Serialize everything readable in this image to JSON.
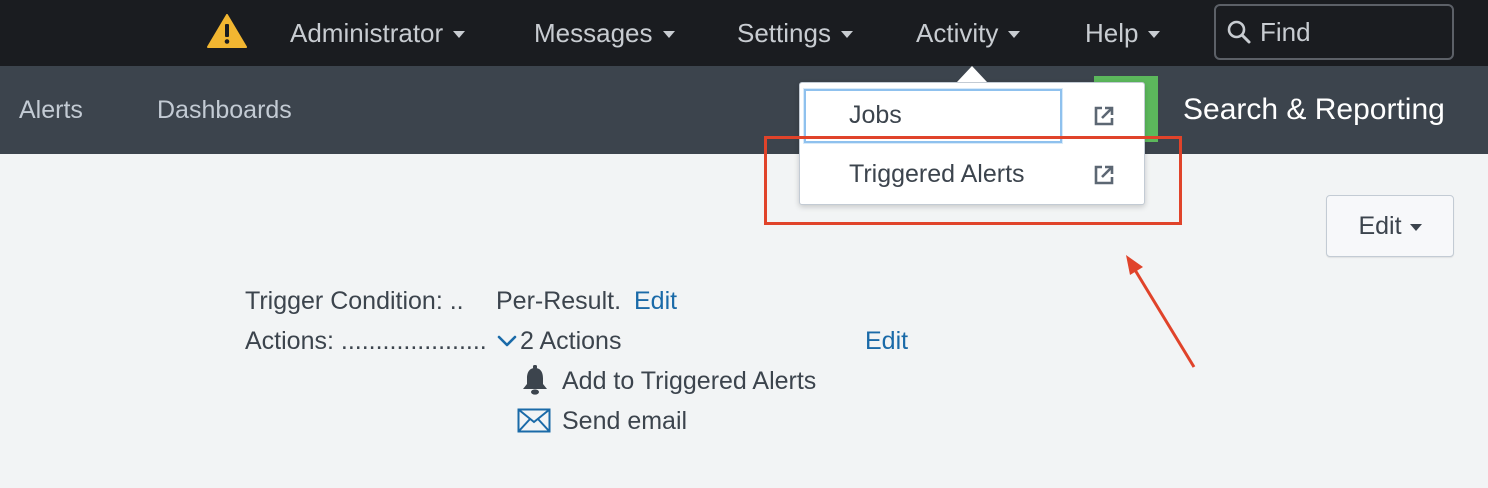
{
  "topnav": {
    "warning_icon": "warning-triangle-icon",
    "items": [
      {
        "label": "Administrator"
      },
      {
        "label": "Messages"
      },
      {
        "label": "Settings"
      },
      {
        "label": "Activity"
      },
      {
        "label": "Help"
      }
    ],
    "find_placeholder": "Find"
  },
  "appbar": {
    "links": [
      {
        "label": "Alerts"
      },
      {
        "label": "Dashboards"
      }
    ],
    "app_title": "Search & Reporting"
  },
  "activity_menu": {
    "items": [
      {
        "label": "Jobs",
        "icon": "external-link-icon"
      },
      {
        "label": "Triggered Alerts",
        "icon": "external-link-icon"
      }
    ]
  },
  "edit_button": {
    "label": "Edit"
  },
  "details": {
    "trigger_label": "Trigger Condition: ..",
    "trigger_value": "Per-Result.",
    "trigger_edit": "Edit",
    "actions_label": "Actions: .....................",
    "actions_value": "2 Actions",
    "actions_edit": "Edit",
    "action_items": [
      {
        "label": "Add to Triggered Alerts",
        "icon": "bell-icon"
      },
      {
        "label": "Send email",
        "icon": "envelope-icon"
      }
    ]
  },
  "colors": {
    "topbar": "#1a1c20",
    "appbar": "#3c444d",
    "link": "#1a6aa8",
    "highlight": "#e0432a",
    "app_accent": "#5cb85c"
  }
}
